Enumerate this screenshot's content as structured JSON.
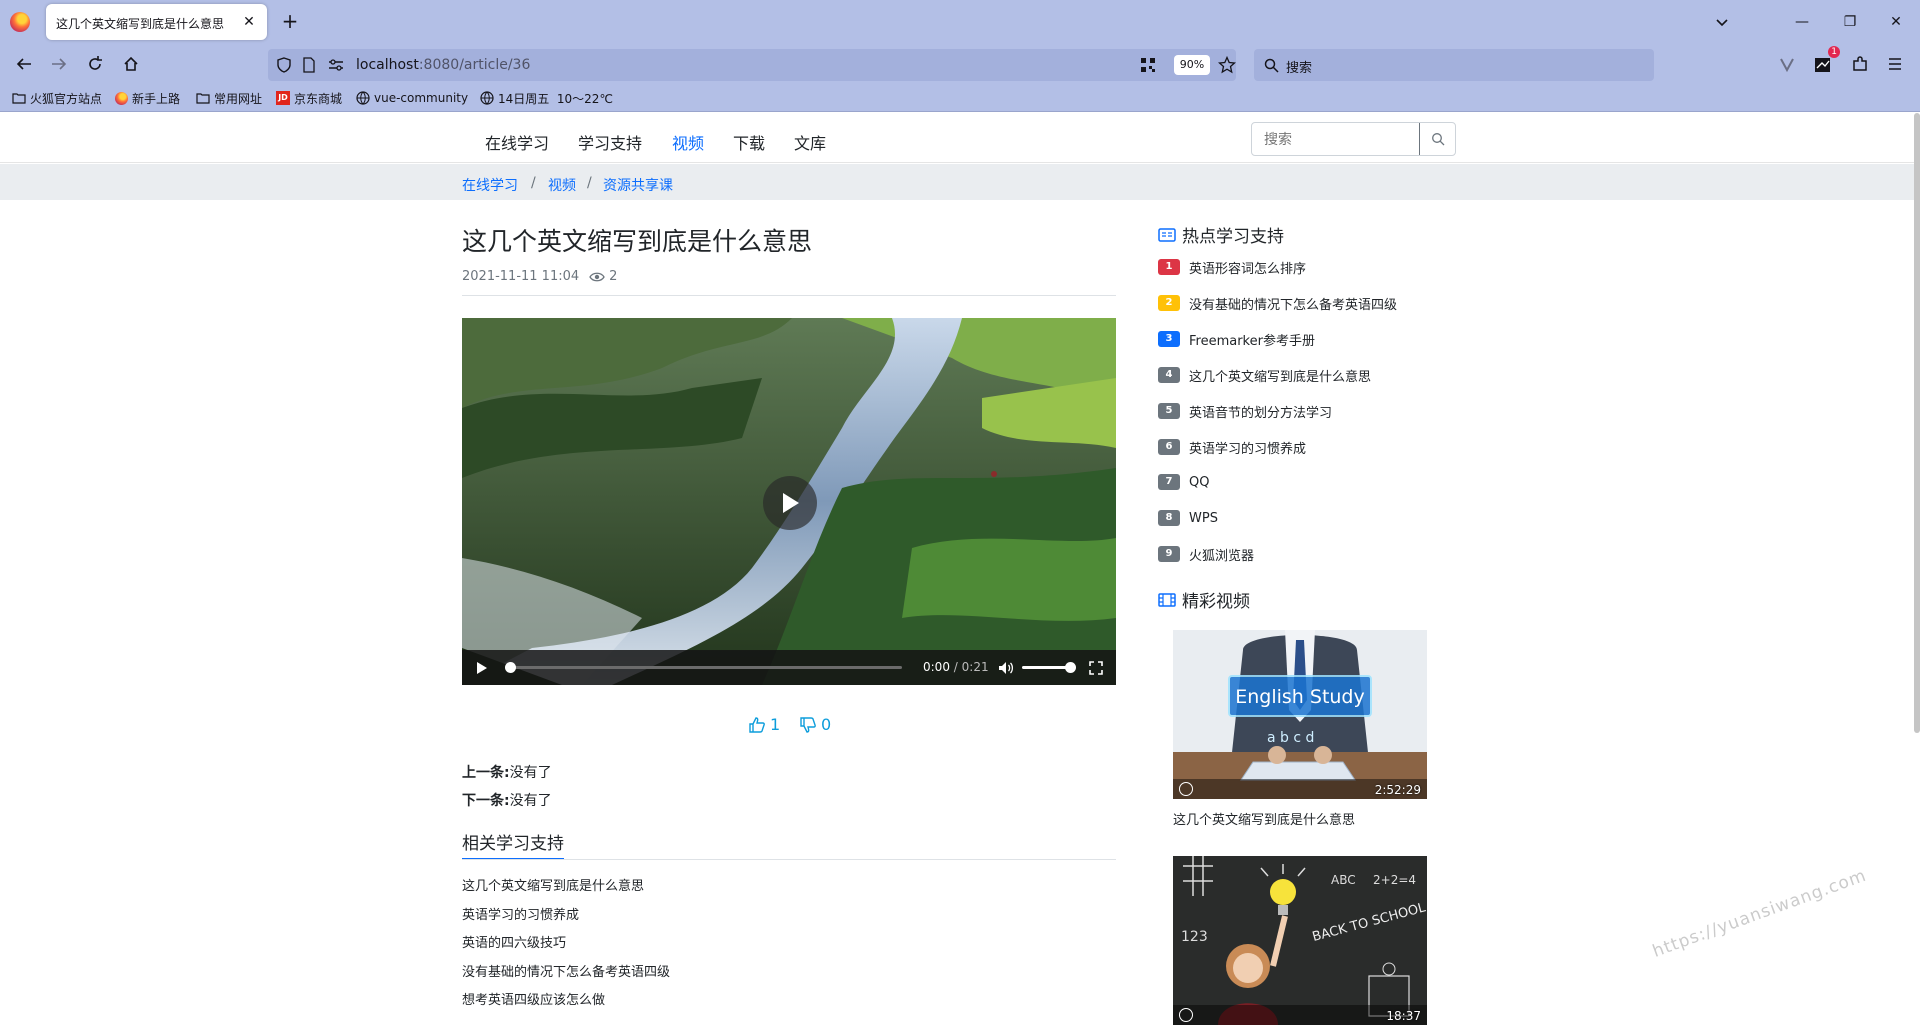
{
  "browser": {
    "tab_title": "这几个英文缩写到底是什么意思",
    "url_host": "localhost",
    "url_path": ":8080/article/36",
    "zoom": "90%",
    "search_placeholder": "搜索",
    "notification_count": "1",
    "bookmarks": [
      "火狐官方站点",
      "新手上路",
      "常用网址",
      "京东商城",
      "vue-community",
      "14日周五  10～22℃"
    ]
  },
  "site": {
    "nav": [
      "在线学习",
      "学习支持",
      "视频",
      "下载",
      "文库"
    ],
    "active_nav": "视频",
    "search_placeholder": "搜索",
    "breadcrumb": [
      "在线学习",
      "视频",
      "资源共享课"
    ]
  },
  "article": {
    "title": "这几个英文缩写到底是什么意思",
    "date": "2021-11-11 11:04",
    "views": "2",
    "video": {
      "current_time": "0:00",
      "duration": "/ 0:21",
      "progress": 0.0,
      "volume": 1.0
    },
    "likes": "1",
    "dislikes": "0",
    "prev_label": "上一条:",
    "prev_value": "没有了",
    "next_label": "下一条:",
    "next_value": "没有了",
    "related_heading": "相关学习支持",
    "related": [
      "这几个英文缩写到底是什么意思",
      "英语学习的习惯养成",
      "英语的四六级技巧",
      "没有基础的情况下怎么备考英语四级",
      "想考英语四级应该怎么做"
    ]
  },
  "sidebar": {
    "hot_heading": "热点学习支持",
    "hot": [
      {
        "rank": "1",
        "title": "英语形容词怎么排序",
        "color": "#dc3545"
      },
      {
        "rank": "2",
        "title": "没有基础的情况下怎么备考英语四级",
        "color": "#ffc107"
      },
      {
        "rank": "3",
        "title": "Freemarker参考手册",
        "color": "#0d6efd"
      },
      {
        "rank": "4",
        "title": "这几个英文缩写到底是什么意思",
        "color": "#6c757d"
      },
      {
        "rank": "5",
        "title": "英语音节的划分方法学习",
        "color": "#6c757d"
      },
      {
        "rank": "6",
        "title": "英语学习的习惯养成",
        "color": "#6c757d"
      },
      {
        "rank": "7",
        "title": "QQ",
        "color": "#6c757d"
      },
      {
        "rank": "8",
        "title": "WPS",
        "color": "#6c757d"
      },
      {
        "rank": "9",
        "title": "火狐浏览器",
        "color": "#6c757d"
      }
    ],
    "video_heading": "精彩视频",
    "videos": [
      {
        "title": "这几个英文缩写到底是什么意思",
        "duration": "2:52:29",
        "thumb_text": "English Study"
      },
      {
        "title": "",
        "duration": "18:37",
        "thumb_text": "BACK TO SCHOOL"
      }
    ]
  },
  "watermark": "https://yuansiwang.com"
}
